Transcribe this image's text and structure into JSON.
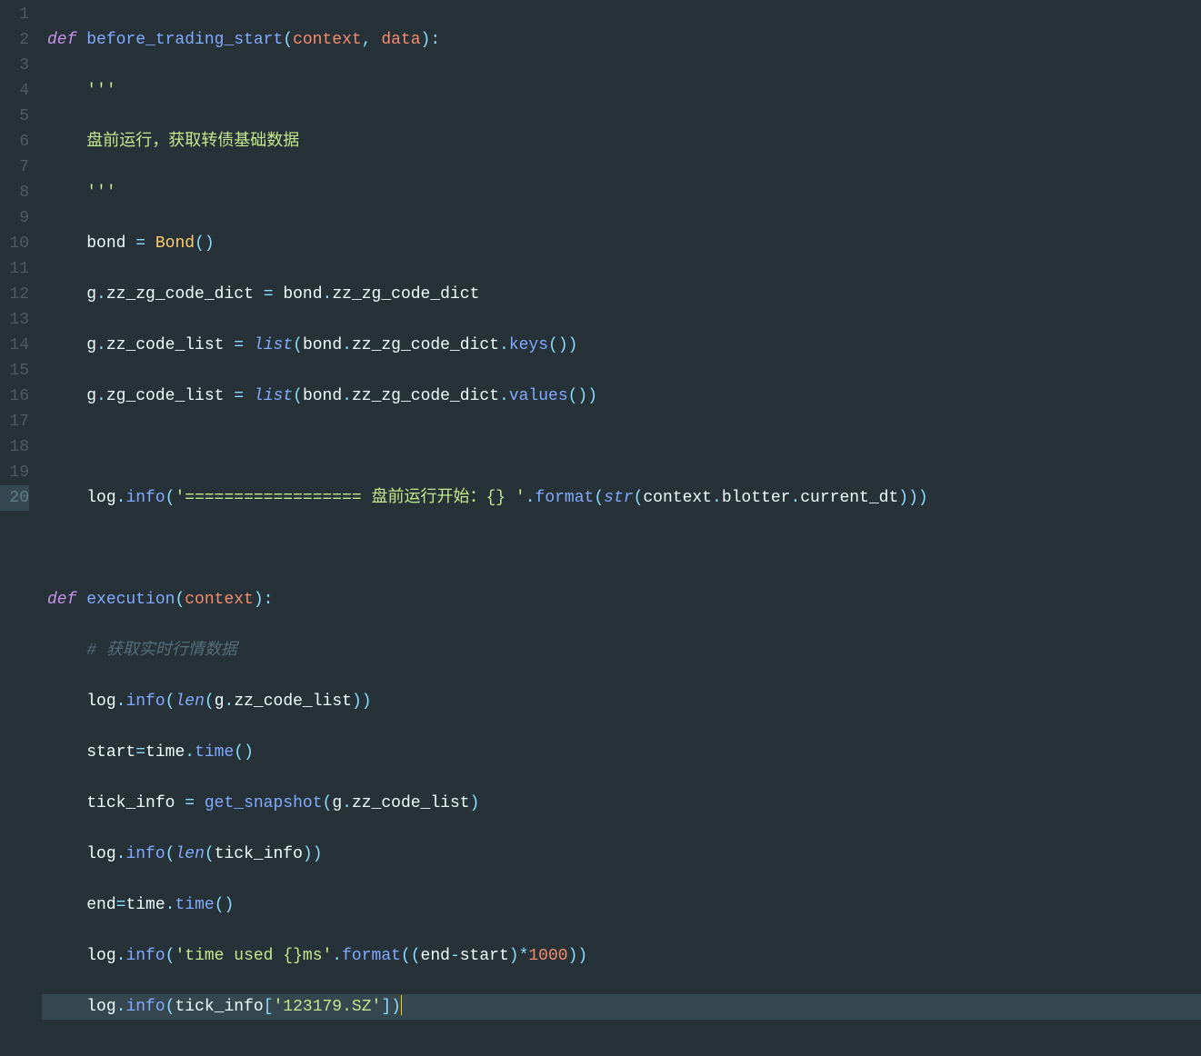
{
  "lineNumbers": [
    "1",
    "2",
    "3",
    "4",
    "5",
    "6",
    "7",
    "8",
    "9",
    "10",
    "11",
    "12",
    "13",
    "14",
    "15",
    "16",
    "17",
    "18",
    "19",
    "20"
  ],
  "currentLine": 20,
  "code": {
    "l1": {
      "kw_def": "def",
      "fn": "before_trading_start",
      "p1": "context",
      "p2": "data"
    },
    "l2": {
      "str": "'''"
    },
    "l3": {
      "str": "盘前运行，获取转债基础数据"
    },
    "l4": {
      "str": "'''"
    },
    "l5": {
      "v": "bond",
      "cls": "Bond"
    },
    "l6": {
      "g": "g",
      "p": "zz_zg_code_dict",
      "b": "bond",
      "bp": "zz_zg_code_dict"
    },
    "l7": {
      "g": "g",
      "p": "zz_code_list",
      "list": "list",
      "b": "bond",
      "bp": "zz_zg_code_dict",
      "m": "keys"
    },
    "l8": {
      "g": "g",
      "p": "zg_code_list",
      "list": "list",
      "b": "bond",
      "bp": "zz_zg_code_dict",
      "m": "values"
    },
    "l10": {
      "log": "log",
      "info": "info",
      "s1": "'================== 盘前运行开始：{} '",
      "fmt": "format",
      "str_": "str",
      "ctx": "context",
      "bl": "blotter",
      "dt": "current_dt"
    },
    "l12": {
      "kw_def": "def",
      "fn": "execution",
      "p1": "context"
    },
    "l13": {
      "cmt": "# 获取实时行情数据"
    },
    "l14": {
      "log": "log",
      "info": "info",
      "len": "len",
      "g": "g",
      "p": "zz_code_list"
    },
    "l15": {
      "v": "start",
      "t": "time",
      "m": "time"
    },
    "l16": {
      "v": "tick_info",
      "fn": "get_snapshot",
      "g": "g",
      "p": "zz_code_list"
    },
    "l17": {
      "log": "log",
      "info": "info",
      "len": "len",
      "v": "tick_info"
    },
    "l18": {
      "v": "end",
      "t": "time",
      "m": "time"
    },
    "l19": {
      "log": "log",
      "info": "info",
      "s": "'time used {}ms'",
      "fmt": "format",
      "e": "end",
      "st": "start",
      "n": "1000"
    },
    "l20": {
      "log": "log",
      "info": "info",
      "v": "tick_info",
      "s": "'123179.SZ'"
    }
  }
}
